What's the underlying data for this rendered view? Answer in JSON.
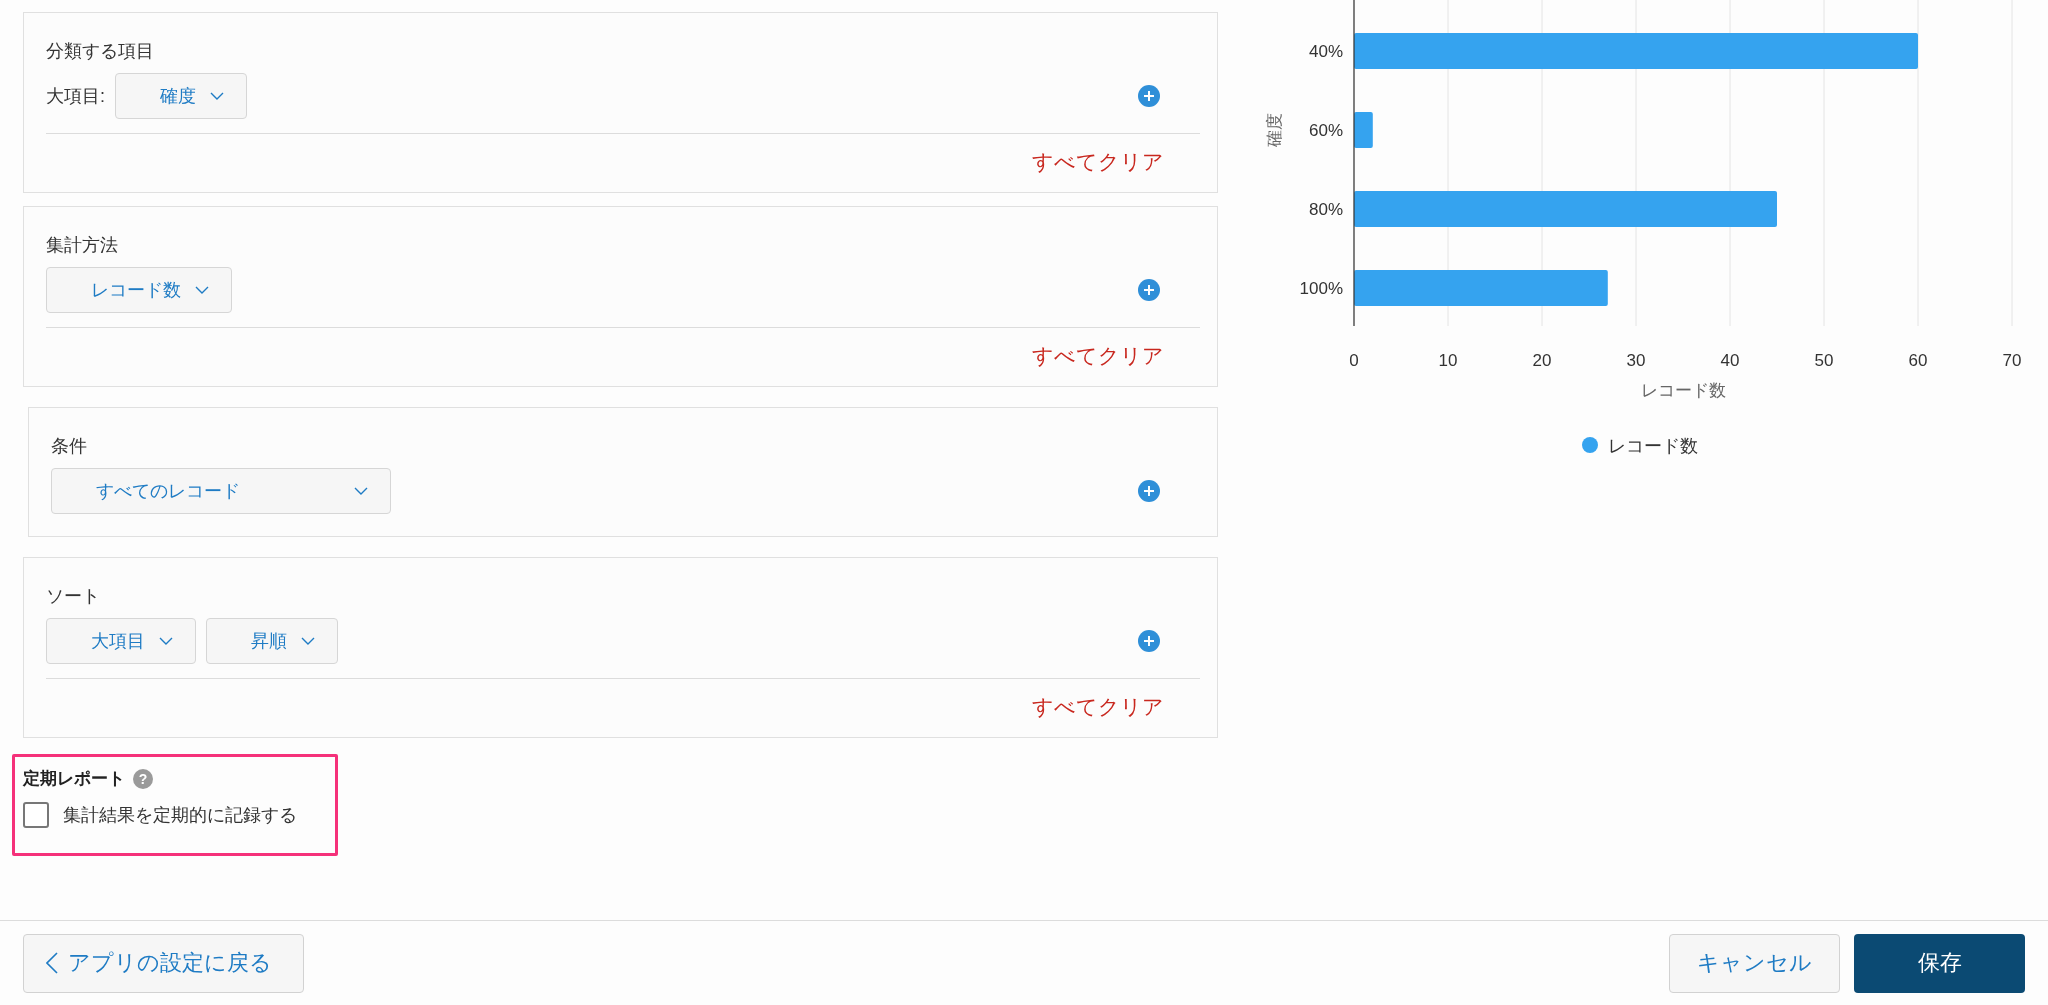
{
  "sections": [
    {
      "title": "分類する項目",
      "fields": [
        {
          "label": "大項目:",
          "value": "確度"
        }
      ],
      "clear": "すべてクリア"
    },
    {
      "title": "集計方法",
      "fields": [
        {
          "value": "レコード数"
        }
      ],
      "clear": "すべてクリア"
    },
    {
      "title": "条件",
      "fields": [
        {
          "value": "すべてのレコード"
        }
      ]
    },
    {
      "title": "ソート",
      "fields": [
        {
          "value": "大項目"
        },
        {
          "value": "昇順"
        }
      ],
      "clear": "すべてクリア"
    }
  ],
  "periodic_report": {
    "title": "定期レポート",
    "help": "?",
    "checkbox": {
      "label": "集計結果を定期的に記録する",
      "checked": false
    }
  },
  "chart": {
    "chart_data": {
      "type": "bar",
      "orientation": "horizontal",
      "xlabel": "レコード数",
      "ylabel": "確度",
      "categories": [
        "40%",
        "60%",
        "80%",
        "100%"
      ],
      "series": [
        {
          "name": "レコード数",
          "color": "#35a3ef",
          "values": [
            60,
            2,
            45,
            27
          ]
        }
      ],
      "xlim": [
        0,
        70
      ],
      "grid": true,
      "xticks": [
        0,
        10,
        20,
        30,
        40,
        50,
        60,
        70
      ]
    }
  },
  "footer": {
    "back": "アプリの設定に戻る",
    "cancel": "キャンセル",
    "save": "保存"
  }
}
